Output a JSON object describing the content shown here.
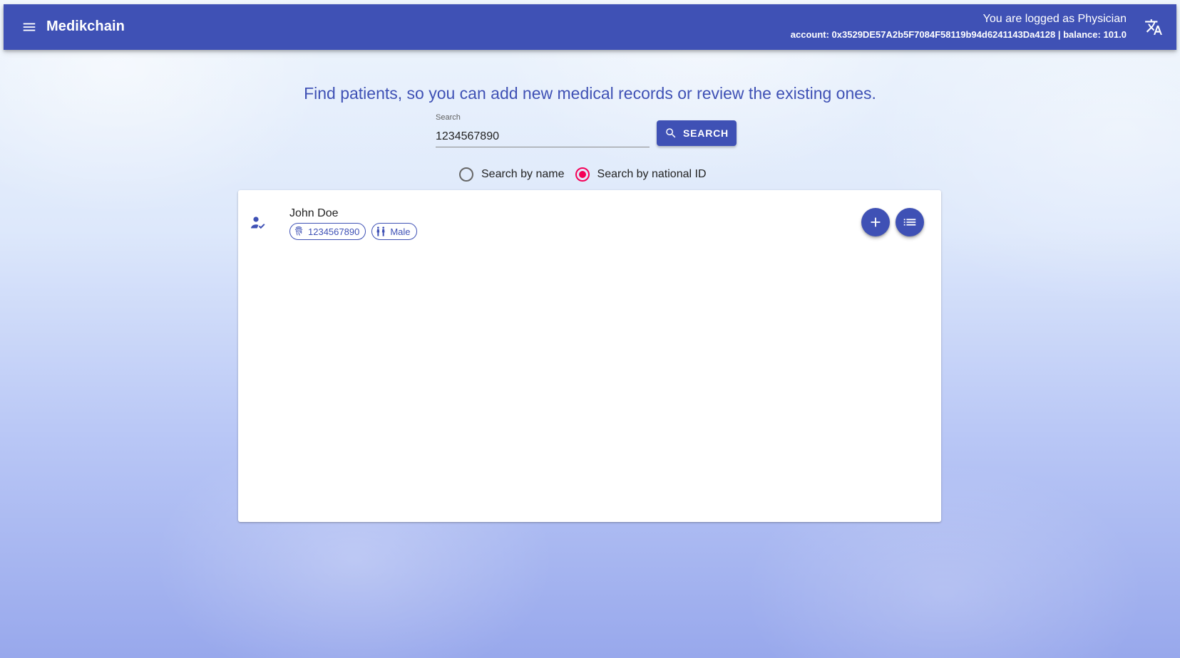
{
  "appbar": {
    "title": "Medikchain",
    "logged_as": "You are logged as Physician",
    "account_line": "account: 0x3529DE57A2b5F7084F58119b94d6241143Da4128 | balance: 101.0",
    "menu_icon": "menu-icon",
    "translate_icon": "translate-icon",
    "color": "#3f51b5"
  },
  "headline": "Find patients, so you can add new medical records or review the existing ones.",
  "search": {
    "label": "Search",
    "value": "1234567890",
    "button_label": "SEARCH"
  },
  "search_mode": {
    "options": [
      {
        "label": "Search by name",
        "checked": false
      },
      {
        "label": "Search by national ID",
        "checked": true
      }
    ],
    "accent": "#f50057"
  },
  "results": [
    {
      "name": "John Doe",
      "national_id": "1234567890",
      "gender": "Male",
      "icons": [
        "person-check-icon",
        "fingerprint-icon",
        "gender-icon"
      ],
      "actions": [
        "add-icon",
        "list-icon"
      ]
    }
  ]
}
